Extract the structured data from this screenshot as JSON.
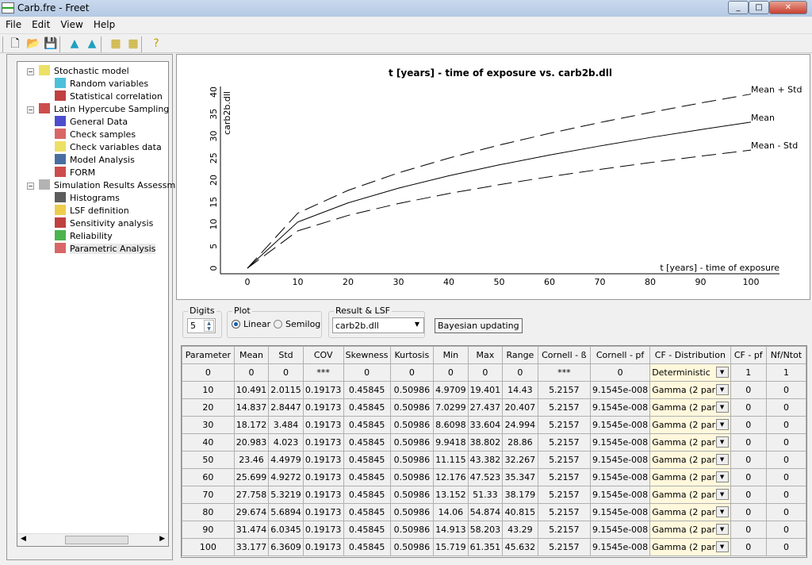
{
  "window": {
    "title": "Carb.fre - Freet",
    "min": "0",
    "max": "1",
    "close": "r"
  },
  "menu": [
    "File",
    "Edit",
    "View",
    "Help"
  ],
  "toolbar": [
    {
      "icon": "new-file-icon",
      "glyph": "🗋"
    },
    {
      "icon": "open-folder-icon",
      "glyph": "📂"
    },
    {
      "icon": "save-icon",
      "glyph": "💾"
    },
    {
      "icon": "distribution-icon-1",
      "glyph": "▲"
    },
    {
      "icon": "distribution-icon-2",
      "glyph": "▲"
    },
    {
      "icon": "grid-icon-1",
      "glyph": "▦"
    },
    {
      "icon": "grid-icon-2",
      "glyph": "▦"
    },
    {
      "icon": "help-icon",
      "glyph": "?"
    }
  ],
  "tree": [
    {
      "label": "Stochastic model",
      "level": 0,
      "icon": "grid-icon",
      "color": "#e8d840"
    },
    {
      "label": "Random variables",
      "level": 1,
      "icon": "distribution-icon",
      "color": "#20b0d0"
    },
    {
      "label": "Statistical correlation",
      "level": 1,
      "icon": "correlation-matrix-icon",
      "color": "#b01010"
    },
    {
      "label": "Latin Hypercube Sampling",
      "level": 0,
      "icon": "curve-icon",
      "color": "#c02020"
    },
    {
      "label": "General Data",
      "level": 1,
      "icon": "decay-curve-icon",
      "color": "#2020c0"
    },
    {
      "label": "Check samples",
      "level": 1,
      "icon": "scatter-icon",
      "color": "#d04040"
    },
    {
      "label": "Check variables data",
      "level": 1,
      "icon": "grid-icon",
      "color": "#e8d840"
    },
    {
      "label": "Model Analysis",
      "level": 1,
      "icon": "calculator-icon",
      "color": "#1a4a8a"
    },
    {
      "label": "FORM",
      "level": 1,
      "icon": "form-icon",
      "color": "#c02020"
    },
    {
      "label": "Simulation Results Assessment",
      "level": 0,
      "icon": "mountain-icon",
      "color": "#a0a0a0"
    },
    {
      "label": "Histograms",
      "level": 1,
      "icon": "histogram-icon",
      "color": "#333333"
    },
    {
      "label": "LSF definition",
      "level": 1,
      "icon": "lsf-icon",
      "color": "#e8c020"
    },
    {
      "label": "Sensitivity analysis",
      "level": 1,
      "icon": "hourglass-icon",
      "color": "#b01010"
    },
    {
      "label": "Reliability",
      "level": 1,
      "icon": "reliability-icon",
      "color": "#20a020"
    },
    {
      "label": "Parametric Analysis",
      "level": 1,
      "icon": "parametric-icon",
      "color": "#d04040",
      "selected": true
    }
  ],
  "controls": {
    "digits_label": "Digits",
    "digits_value": "5",
    "plot_label": "Plot",
    "linear": "Linear",
    "semilog": "Semilog",
    "plot_selected": "Linear",
    "result_label": "Result & LSF",
    "result_value": "carb2b.dll",
    "bayes": "Bayesian updating"
  },
  "chart_data": {
    "type": "line",
    "title": "t [years] - time of exposure vs. carb2b.dll",
    "xlabel": "t [years] - time of exposure",
    "ylabel": "carb2b.dll",
    "x": [
      0,
      10,
      20,
      30,
      40,
      50,
      60,
      70,
      80,
      90,
      100
    ],
    "xticks": [
      0,
      10,
      20,
      30,
      40,
      50,
      60,
      70,
      80,
      90,
      100
    ],
    "yticks": [
      0,
      5,
      10,
      15,
      20,
      25,
      30,
      35,
      40
    ],
    "ylim": [
      0,
      40
    ],
    "grid": false,
    "series": [
      {
        "name": "Mean + Std",
        "style": "dashed",
        "values": [
          0,
          12.5025,
          17.6817,
          21.656,
          25.006,
          27.9579,
          30.6262,
          33.0799,
          35.3634,
          37.5085,
          39.5379
        ]
      },
      {
        "name": "Mean",
        "style": "solid",
        "values": [
          0,
          10.491,
          14.837,
          18.172,
          20.983,
          23.46,
          25.699,
          27.758,
          29.674,
          31.474,
          33.177
        ]
      },
      {
        "name": "Mean - Std",
        "style": "dashed",
        "values": [
          0,
          8.4795,
          11.9923,
          14.688,
          16.96,
          18.9621,
          20.7718,
          22.4361,
          23.9846,
          25.4395,
          26.8161
        ]
      }
    ]
  },
  "table": {
    "headers": [
      "Parameter",
      "Mean",
      "Std",
      "COV",
      "Skewness",
      "Kurtosis",
      "Min",
      "Max",
      "Range",
      "Cornell - ß",
      "Cornell - pf",
      "CF - Distribution",
      "CF - pf",
      "Nf/Ntot"
    ],
    "rows": [
      [
        "0",
        "0",
        "0",
        "***",
        "0",
        "0",
        "0",
        "0",
        "0",
        "***",
        "0",
        "Deterministic",
        "1",
        "1"
      ],
      [
        "10",
        "10.491",
        "2.0115",
        "0.19173",
        "0.45845",
        "0.50986",
        "4.9709",
        "19.401",
        "14.43",
        "5.2157",
        "9.1545e-008",
        "Gamma (2 par)",
        "0",
        "0"
      ],
      [
        "20",
        "14.837",
        "2.8447",
        "0.19173",
        "0.45845",
        "0.50986",
        "7.0299",
        "27.437",
        "20.407",
        "5.2157",
        "9.1545e-008",
        "Gamma (2 par)",
        "0",
        "0"
      ],
      [
        "30",
        "18.172",
        "3.484",
        "0.19173",
        "0.45845",
        "0.50986",
        "8.6098",
        "33.604",
        "24.994",
        "5.2157",
        "9.1545e-008",
        "Gamma (2 par)",
        "0",
        "0"
      ],
      [
        "40",
        "20.983",
        "4.023",
        "0.19173",
        "0.45845",
        "0.50986",
        "9.9418",
        "38.802",
        "28.86",
        "5.2157",
        "9.1545e-008",
        "Gamma (2 par)",
        "0",
        "0"
      ],
      [
        "50",
        "23.46",
        "4.4979",
        "0.19173",
        "0.45845",
        "0.50986",
        "11.115",
        "43.382",
        "32.267",
        "5.2157",
        "9.1545e-008",
        "Gamma (2 par)",
        "0",
        "0"
      ],
      [
        "60",
        "25.699",
        "4.9272",
        "0.19173",
        "0.45845",
        "0.50986",
        "12.176",
        "47.523",
        "35.347",
        "5.2157",
        "9.1545e-008",
        "Gamma (2 par)",
        "0",
        "0"
      ],
      [
        "70",
        "27.758",
        "5.3219",
        "0.19173",
        "0.45845",
        "0.50986",
        "13.152",
        "51.33",
        "38.179",
        "5.2157",
        "9.1545e-008",
        "Gamma (2 par)",
        "0",
        "0"
      ],
      [
        "80",
        "29.674",
        "5.6894",
        "0.19173",
        "0.45845",
        "0.50986",
        "14.06",
        "54.874",
        "40.815",
        "5.2157",
        "9.1545e-008",
        "Gamma (2 par)",
        "0",
        "0"
      ],
      [
        "90",
        "31.474",
        "6.0345",
        "0.19173",
        "0.45845",
        "0.50986",
        "14.913",
        "58.203",
        "43.29",
        "5.2157",
        "9.1545e-008",
        "Gamma (2 par)",
        "0",
        "0"
      ],
      [
        "100",
        "33.177",
        "6.3609",
        "0.19173",
        "0.45845",
        "0.50986",
        "15.719",
        "61.351",
        "45.632",
        "5.2157",
        "9.1545e-008",
        "Gamma (2 par)",
        "0",
        "0"
      ]
    ]
  }
}
